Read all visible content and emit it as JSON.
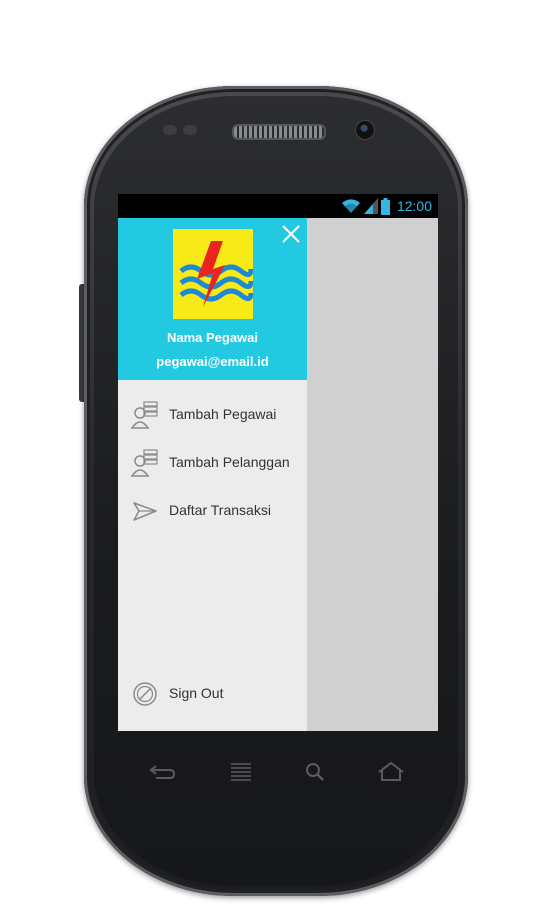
{
  "status_bar": {
    "time": "12:00"
  },
  "drawer": {
    "user_name": "Nama Pegawai",
    "user_email": "pegawai@email.id",
    "items": [
      {
        "label": "Tambah Pegawai",
        "icon": "add-user-icon"
      },
      {
        "label": "Tambah Pelanggan",
        "icon": "add-user-icon"
      },
      {
        "label": "Daftar Transaksi",
        "icon": "send-icon"
      }
    ],
    "sign_out": {
      "label": "Sign Out",
      "icon": "block-icon"
    }
  },
  "colors": {
    "header": "#22c9e0",
    "drawer_bg": "#ececec",
    "logo_bg": "#f8ea16",
    "status_accent": "#33b5e5"
  }
}
